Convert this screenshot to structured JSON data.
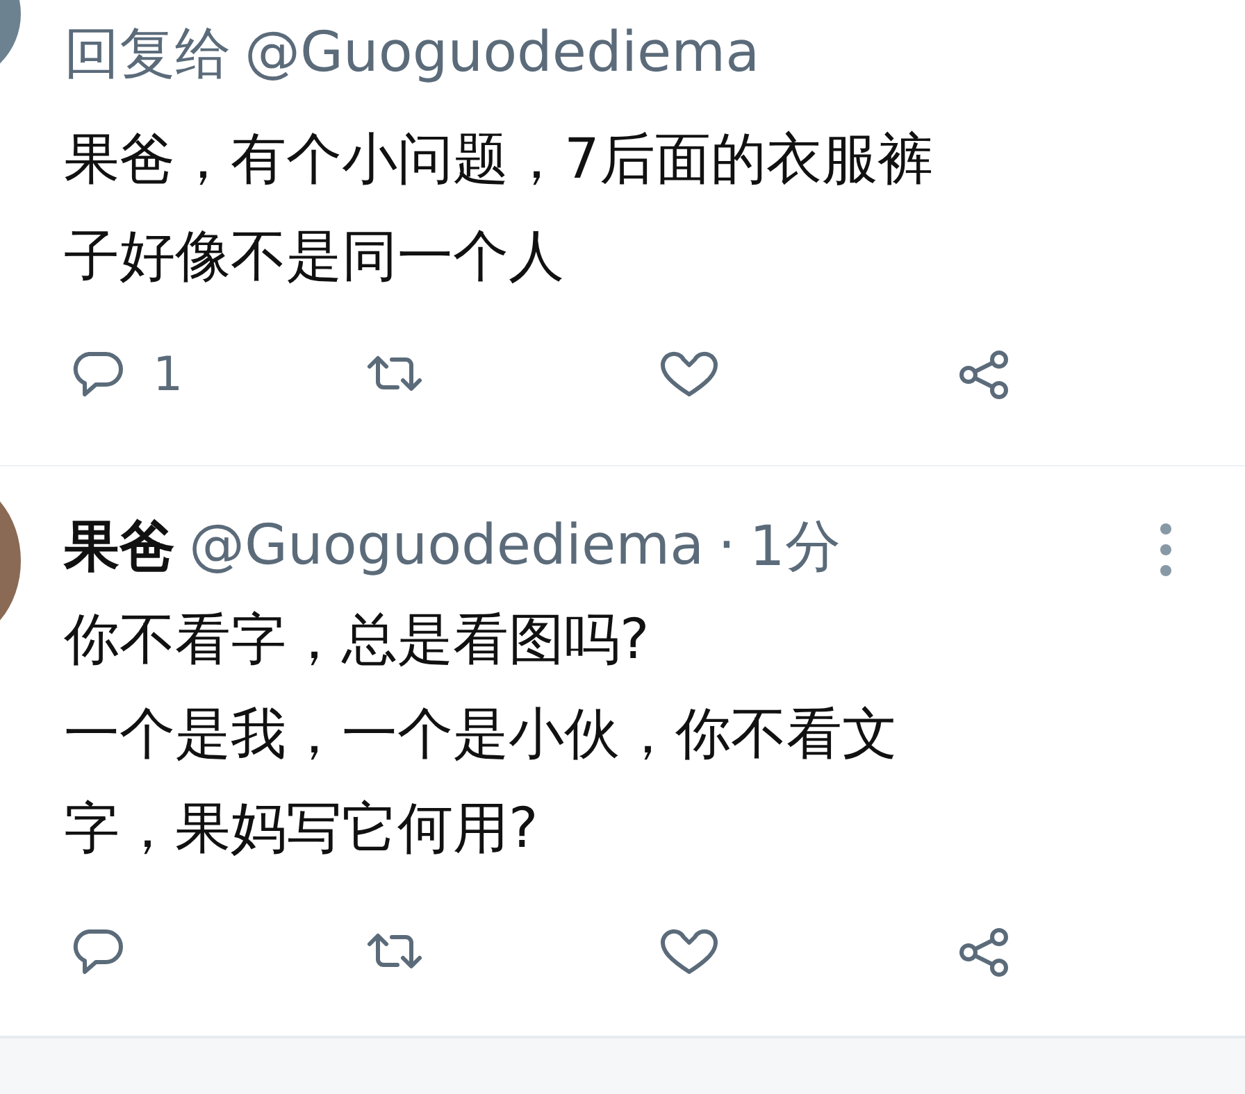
{
  "tweets": [
    {
      "reply_to": {
        "prefix": "回复给",
        "handle": "@Guoguodediema"
      },
      "text": "果爸，有个小问题，7后面的衣服裤子好像不是同一个人",
      "actions": [
        {
          "kind": "reply",
          "count": "1"
        },
        {
          "kind": "retweet"
        },
        {
          "kind": "like"
        },
        {
          "kind": "share"
        }
      ]
    },
    {
      "author": {
        "name": "果爸",
        "handle": "@Guoguodediema",
        "separator": "·",
        "time": "1分"
      },
      "text": "你不看字，总是看图吗?\n一个是我，一个是小伙，你不看文字，果妈写它何用?",
      "actions": [
        {
          "kind": "reply"
        },
        {
          "kind": "retweet"
        },
        {
          "kind": "like"
        },
        {
          "kind": "share"
        }
      ]
    }
  ]
}
